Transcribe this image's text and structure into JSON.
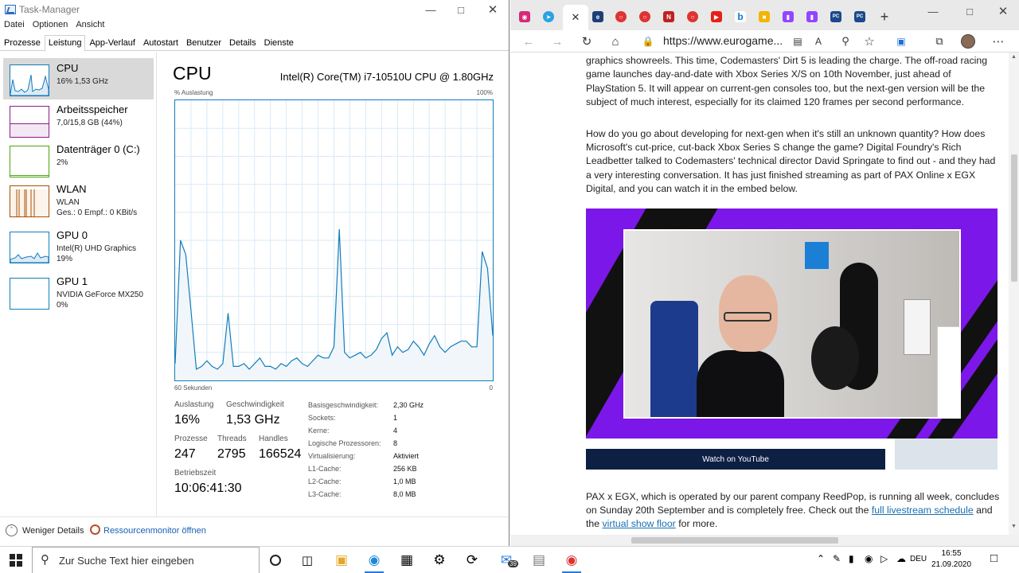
{
  "taskmgr": {
    "title": "Task-Manager",
    "menu": [
      "Datei",
      "Optionen",
      "Ansicht"
    ],
    "tabs": [
      "Prozesse",
      "Leistung",
      "App-Verlauf",
      "Autostart",
      "Benutzer",
      "Details",
      "Dienste"
    ],
    "active_tab": "Leistung",
    "sidebar": [
      {
        "name": "CPU",
        "line1": "16% 1,53 GHz",
        "line2": "",
        "color": "#117dbb",
        "selected": true
      },
      {
        "name": "Arbeitsspeicher",
        "line1": "7,0/15,8 GB (44%)",
        "line2": "",
        "color": "#8b1d8b"
      },
      {
        "name": "Datenträger 0 (C:)",
        "line1": "2%",
        "line2": "",
        "color": "#4da60c"
      },
      {
        "name": "WLAN",
        "line1": "WLAN",
        "line2": "Ges.: 0 Empf.: 0 KBit/s",
        "color": "#a74f01"
      },
      {
        "name": "GPU 0",
        "line1": "Intel(R) UHD Graphics",
        "line2": "19%",
        "color": "#117dbb"
      },
      {
        "name": "GPU 1",
        "line1": "NVIDIA GeForce MX250",
        "line2": "0%",
        "color": "#117dbb"
      }
    ],
    "main": {
      "title": "CPU",
      "model": "Intel(R) Core(TM) i7-10510U CPU @ 1.80GHz",
      "axis_label": "% Auslastung",
      "axis_max": "100%",
      "axis_time": "60 Sekunden",
      "axis_min": "0",
      "stats": {
        "util_label": "Auslastung",
        "util": "16%",
        "speed_label": "Geschwindigkeit",
        "speed": "1,53 GHz",
        "proc_label": "Prozesse",
        "proc": "247",
        "threads_label": "Threads",
        "threads": "2795",
        "handles_label": "Handles",
        "handles": "166524",
        "uptime_label": "Betriebszeit",
        "uptime": "10:06:41:30"
      },
      "details": [
        {
          "k": "Basisgeschwindigkeit:",
          "v": "2,30 GHz"
        },
        {
          "k": "Sockets:",
          "v": "1"
        },
        {
          "k": "Kerne:",
          "v": "4"
        },
        {
          "k": "Logische Prozessoren:",
          "v": "8"
        },
        {
          "k": "Virtualisierung:",
          "v": "Aktiviert"
        },
        {
          "k": "L1-Cache:",
          "v": "256 KB"
        },
        {
          "k": "L2-Cache:",
          "v": "1,0 MB"
        },
        {
          "k": "L3-Cache:",
          "v": "8,0 MB"
        }
      ]
    },
    "chart_data": {
      "type": "area",
      "x": [
        0,
        1,
        2,
        3,
        4,
        5,
        6,
        7,
        8,
        9,
        10,
        11,
        12,
        13,
        14,
        15,
        16,
        17,
        18,
        19,
        20,
        21,
        22,
        23,
        24,
        25,
        26,
        27,
        28,
        29,
        30,
        31,
        32,
        33,
        34,
        35,
        36,
        37,
        38,
        39,
        40,
        41,
        42,
        43,
        44,
        45,
        46,
        47,
        48,
        49,
        50,
        51,
        52,
        53,
        54,
        55,
        56,
        57,
        58,
        59,
        60
      ],
      "values": [
        6,
        50,
        45,
        25,
        4,
        5,
        7,
        5,
        4,
        6,
        24,
        5,
        5,
        6,
        4,
        6,
        8,
        5,
        5,
        4,
        6,
        5,
        7,
        8,
        6,
        5,
        7,
        9,
        8,
        8,
        12,
        54,
        10,
        8,
        9,
        10,
        8,
        9,
        11,
        15,
        17,
        9,
        12,
        10,
        11,
        14,
        12,
        9,
        13,
        16,
        12,
        10,
        12,
        13,
        14,
        14,
        12,
        12,
        46,
        40,
        16
      ],
      "ylim": [
        0,
        100
      ],
      "xlabel": "60 Sekunden",
      "ylabel": "% Auslastung",
      "color": "#117dbb"
    },
    "footer": {
      "less": "Weniger Details",
      "monitor": "Ressourcenmonitor öffnen"
    }
  },
  "browser": {
    "url": "https://www.eurogame...",
    "para1": "comes around - there's something about those gleaming car models that makes for excellent graphics showreels. This time, Codemasters' Dirt 5 is leading the charge. The off-road racing game launches day-and-date with Xbox Series X/S on 10th November, just ahead of PlayStation 5. It will appear on current-gen consoles too, but the next-gen version will be the subject of much interest, especially for its claimed 120 frames per second performance.",
    "para2": "How do you go about developing for next-gen when it's still an unknown quantity? How does Microsoft's cut-price, cut-back Xbox Series S change the game? Digital Foundry's Rich Leadbetter talked to Codemasters' technical director David Springate to find out - and they had a very interesting conversation. It has just finished streaming as part of PAX Online x EGX Digital, and you can watch it in the embed below.",
    "watch": "Watch on YouTube",
    "para3_a": "PAX x EGX, which is operated by our parent company ReedPop, is running all week, concludes on Sunday 20th September and is completely free. Check out the ",
    "link1": "full livestream schedule",
    "para3_b": " and the ",
    "link2": "virtual show floor",
    "para3_c": " for more."
  },
  "taskbar": {
    "search_placeholder": "Zur Suche Text hier eingeben",
    "badge": "39",
    "lang": "DEU",
    "time": "16:55",
    "date": "21.09.2020"
  }
}
